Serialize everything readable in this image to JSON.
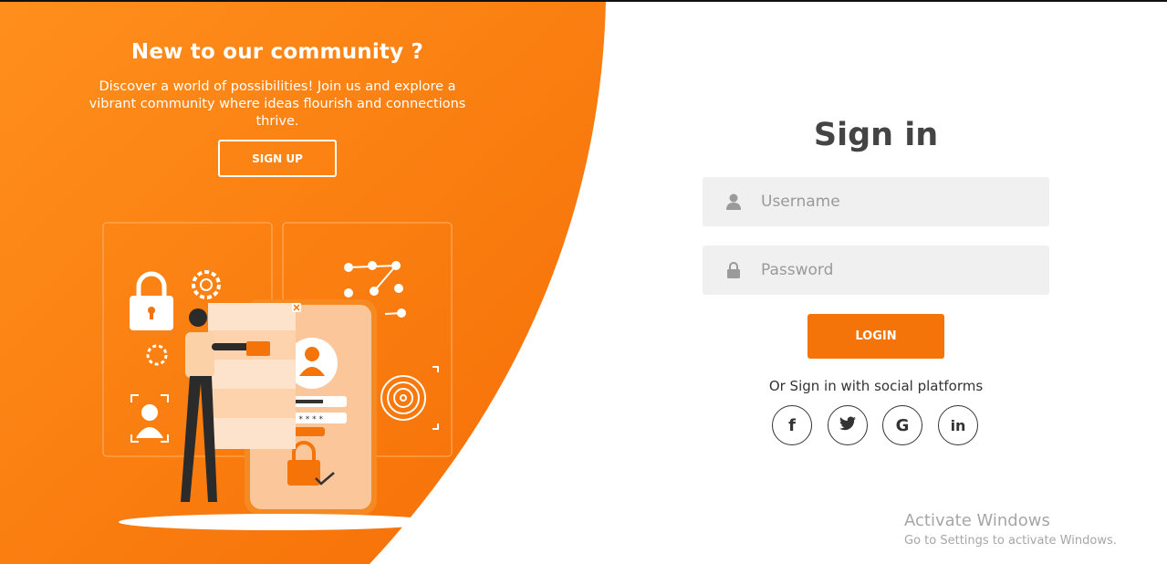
{
  "colors": {
    "accent": "#f5740a",
    "accent_light": "#ff8f1c",
    "text_dark": "#444444"
  },
  "promo": {
    "title": "New to our community ?",
    "text": "Discover a world of possibilities! Join us and explore a vibrant community where ideas flourish and connections thrive.",
    "signup_label": "SIGN UP"
  },
  "signin": {
    "title": "Sign in",
    "username_placeholder": "Username",
    "password_placeholder": "Password",
    "login_label": "LOGIN",
    "social_text": "Or Sign in with social platforms"
  },
  "social": {
    "facebook": "f",
    "twitter_icon": "twitter-icon",
    "google": "G",
    "linkedin": "in"
  },
  "watermark": {
    "title": "Activate Windows",
    "subtitle": "Go to Settings to activate Windows."
  }
}
